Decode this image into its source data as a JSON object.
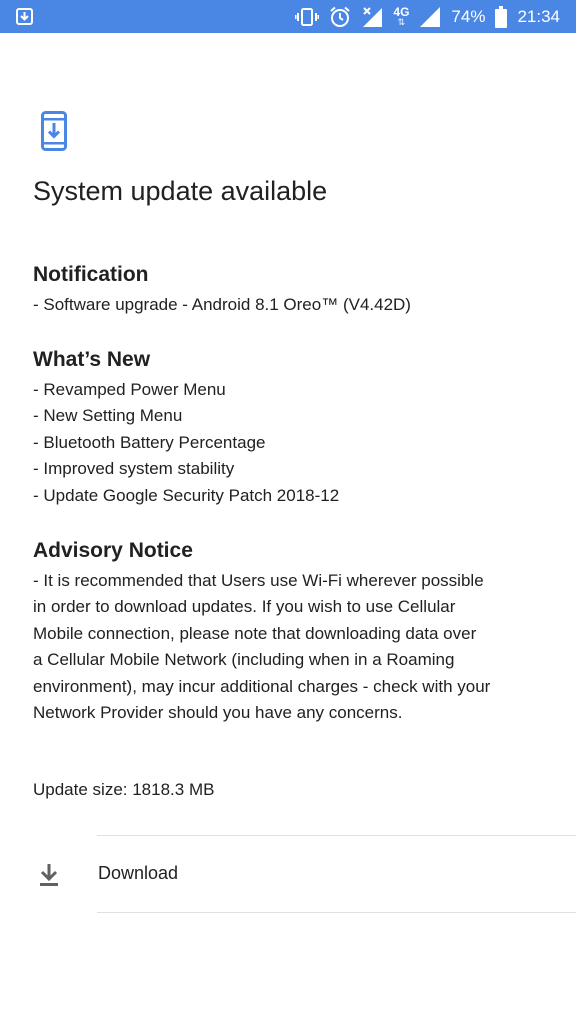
{
  "status_bar": {
    "left_icon": "download-notification-icon",
    "icons": [
      "vibrate-icon",
      "alarm-icon",
      "signal-x-icon",
      "4g-icon",
      "signal-icon",
      "battery-icon"
    ],
    "network_label": "4G",
    "battery": "74%",
    "time": "21:34",
    "colors": {
      "background": "#4a87e5",
      "foreground": "#ffffff"
    }
  },
  "header": {
    "icon": "system-update-icon",
    "icon_color": "#4a87e5",
    "title": "System update available"
  },
  "notification": {
    "heading": "Notification",
    "lines": [
      "- Software upgrade - Android 8.1 Oreo™ (V4.42D)"
    ]
  },
  "whats_new": {
    "heading": "What’s New",
    "lines": [
      "- Revamped Power Menu",
      "- New Setting Menu",
      "- Bluetooth Battery Percentage",
      "- Improved system stability",
      "- Update Google Security Patch 2018-12"
    ]
  },
  "advisory": {
    "heading": "Advisory Notice",
    "lines": [
      "- It is recommended that Users use Wi-Fi wherever possible",
      "in order to download updates. If you wish to use Cellular",
      "Mobile connection, please note that downloading data over",
      "a Cellular Mobile Network (including when in a Roaming",
      "environment), may incur additional charges - check with your",
      "Network Provider should you have any concerns."
    ]
  },
  "update_size": "Update size: 1818.3 MB",
  "download": {
    "icon": "download-icon",
    "label": "Download"
  }
}
